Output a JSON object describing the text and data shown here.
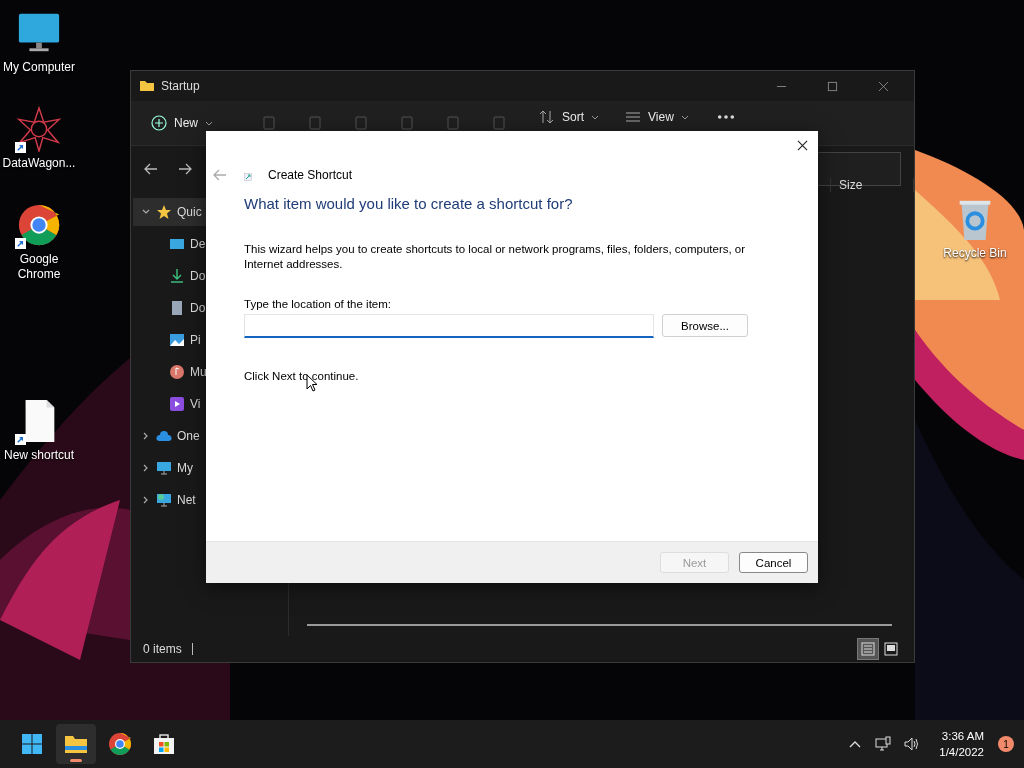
{
  "desktop_icons": [
    {
      "label": "My Computer",
      "kind": "monitor",
      "shortcut": false
    },
    {
      "label": "DataWagon...",
      "kind": "star",
      "shortcut": true
    },
    {
      "label": "Google Chrome",
      "kind": "chrome",
      "shortcut": true
    },
    {
      "label": "New shortcut",
      "kind": "file",
      "shortcut": true
    },
    {
      "label": "Recycle Bin",
      "kind": "bin",
      "shortcut": false
    }
  ],
  "explorer": {
    "title": "Startup",
    "toolbar": [
      {
        "label": "New",
        "kind": "new"
      },
      {
        "label": "Sort",
        "kind": "sort"
      },
      {
        "label": "View",
        "kind": "view"
      }
    ],
    "sidebar": [
      {
        "label": "Quic",
        "kind": "star",
        "expanded": true,
        "selected": true,
        "children": [
          {
            "label": "De",
            "kind": "desktop",
            "selected": false
          },
          {
            "label": "Do",
            "kind": "download",
            "selected": false
          },
          {
            "label": "Do",
            "kind": "document",
            "selected": false
          },
          {
            "label": "Pi",
            "kind": "pictures",
            "selected": false
          },
          {
            "label": "Mu",
            "kind": "music",
            "selected": false
          },
          {
            "label": "Vi",
            "kind": "videos",
            "selected": false
          }
        ]
      },
      {
        "label": "One",
        "kind": "cloud",
        "expanded": false,
        "selected": false
      },
      {
        "label": "My",
        "kind": "monitor",
        "expanded": false,
        "selected": false
      },
      {
        "label": "Net",
        "kind": "network",
        "expanded": false,
        "selected": false
      }
    ],
    "columns": [
      "Size"
    ],
    "status": "0 items",
    "view_buttons": [
      {
        "kind": "details",
        "selected": true
      },
      {
        "kind": "tiles",
        "selected": false
      }
    ]
  },
  "dialog": {
    "title": "Create Shortcut",
    "heading": "What item would you like to create a shortcut for?",
    "description": "This wizard helps you to create shortcuts to local or network programs, files, folders, computers, or Internet addresses.",
    "field_label": "Type the location of the item:",
    "browse": "Browse...",
    "hint": "Click Next to continue.",
    "buttons": [
      {
        "label": "Next",
        "disabled": true
      },
      {
        "label": "Cancel",
        "disabled": false
      }
    ]
  },
  "taskbar": {
    "apps": [
      {
        "kind": "start",
        "active": false
      },
      {
        "kind": "explorer",
        "active": true
      },
      {
        "kind": "chrome",
        "active": false
      },
      {
        "kind": "store",
        "active": false
      }
    ],
    "time": "3:36 AM",
    "date": "1/4/2022",
    "notifications": "1"
  }
}
